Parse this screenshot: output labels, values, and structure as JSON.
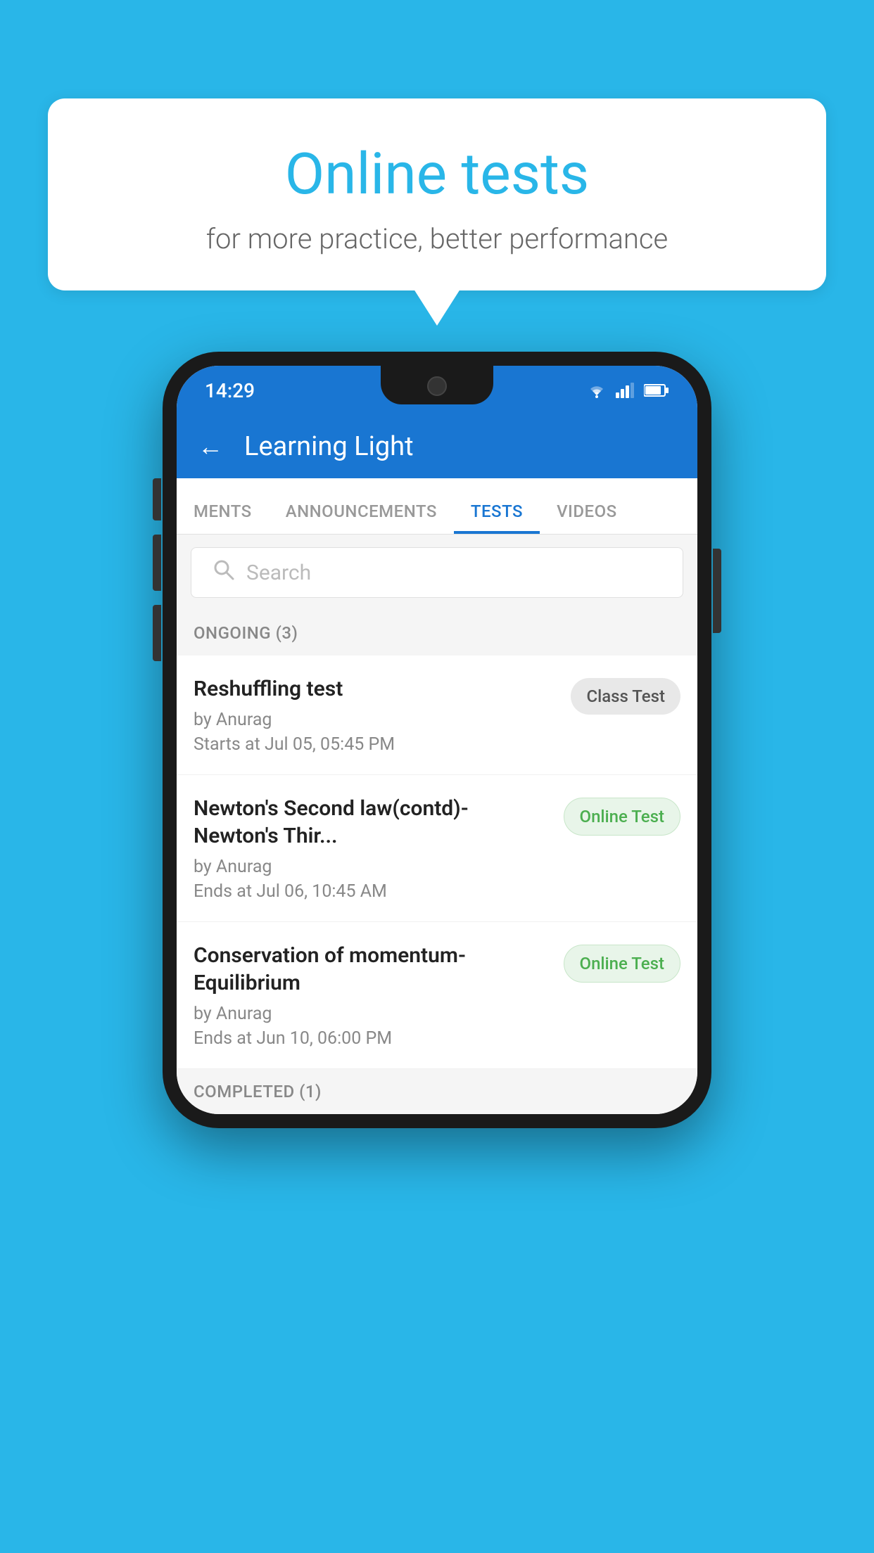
{
  "background": {
    "color": "#29b6e8"
  },
  "speech_bubble": {
    "title": "Online tests",
    "subtitle": "for more practice, better performance"
  },
  "phone": {
    "status_bar": {
      "time": "14:29",
      "icons": [
        "wifi",
        "signal",
        "battery"
      ]
    },
    "app_bar": {
      "title": "Learning Light",
      "back_label": "←"
    },
    "tabs": [
      {
        "label": "MENTS",
        "active": false
      },
      {
        "label": "ANNOUNCEMENTS",
        "active": false
      },
      {
        "label": "TESTS",
        "active": true
      },
      {
        "label": "VIDEOS",
        "active": false
      }
    ],
    "search": {
      "placeholder": "Search"
    },
    "sections": [
      {
        "header": "ONGOING (3)",
        "items": [
          {
            "name": "Reshuffling test",
            "author": "by Anurag",
            "date": "Starts at  Jul 05, 05:45 PM",
            "badge": "Class Test",
            "badge_type": "class"
          },
          {
            "name": "Newton's Second law(contd)-Newton's Thir...",
            "author": "by Anurag",
            "date": "Ends at  Jul 06, 10:45 AM",
            "badge": "Online Test",
            "badge_type": "online"
          },
          {
            "name": "Conservation of momentum-Equilibrium",
            "author": "by Anurag",
            "date": "Ends at  Jun 10, 06:00 PM",
            "badge": "Online Test",
            "badge_type": "online"
          }
        ]
      }
    ],
    "completed_section": {
      "header": "COMPLETED (1)"
    }
  }
}
